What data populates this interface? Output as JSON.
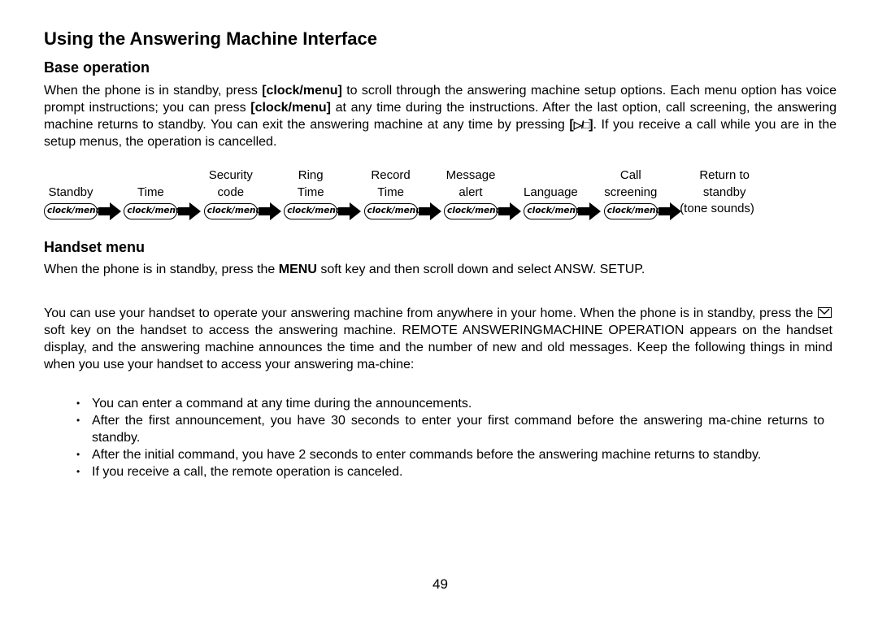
{
  "document": {
    "title": "Using the Answering Machine Interface",
    "page_number": "49"
  },
  "base_operation": {
    "heading": "Base operation",
    "paragraph": {
      "t1": "When the phone is in standby, press ",
      "k1": "[clock/menu]",
      "t2": " to scroll through the answering machine setup options. Each menu option has voice prompt instructions; you can press ",
      "k2": "[clock/menu]",
      "t3": " at any time during the instructions. After the last option, call screening, the answering machine returns to standby. You can exit the answering machine at any time by pressing ",
      "k3_open": "[",
      "k3_icon": "play-stop-icon",
      "k3_glyph": "▷/□",
      "k3_close": "]",
      "t4": ". If you receive a call while you are in the setup menus, the operation is cancelled."
    },
    "flow": {
      "key_label": "clock/menu",
      "arrow_icon": "right-arrow-icon",
      "steps": [
        {
          "line1": "",
          "line2": "Standby"
        },
        {
          "line1": "",
          "line2": "Time"
        },
        {
          "line1": "Security",
          "line2": "code"
        },
        {
          "line1": "Ring",
          "line2": "Time"
        },
        {
          "line1": "Record",
          "line2": "Time"
        },
        {
          "line1": "Message",
          "line2": "alert"
        },
        {
          "line1": "",
          "line2": "Language"
        },
        {
          "line1": "Call",
          "line2": "screening"
        }
      ],
      "final": {
        "line1": "Return to",
        "line2": "standby",
        "line3": "(tone sounds)"
      }
    }
  },
  "handset_menu": {
    "heading": "Handset menu",
    "paragraph": {
      "t1": "When the phone is in standby, press the ",
      "k1": "MENU",
      "t2": " soft key and then scroll down and select ANSW. SETUP."
    },
    "remote_paragraph": {
      "t1": "You can use your handset to operate your answering machine from anywhere in your home. When the phone is in standby, press the ",
      "icon": "envelope-icon",
      "t2": " soft key on the handset to access the answering machine. REMOTE ANSWERINGMACHINE OPERATION appears on the handset display, and the answering machine announces the time and the number of new and old messages. Keep the following things in mind when you use your handset to access your answering ma-chine:"
    },
    "bullets": [
      "You can enter a command at any time during the announcements.",
      "After the first announcement, you have 30 seconds to enter your first command before the answering ma-chine returns to standby.",
      "After the initial command, you have 2 seconds to enter commands before the answering machine returns to standby.",
      "If you receive a call, the remote operation is canceled."
    ],
    "bullet_glyph": "•"
  }
}
